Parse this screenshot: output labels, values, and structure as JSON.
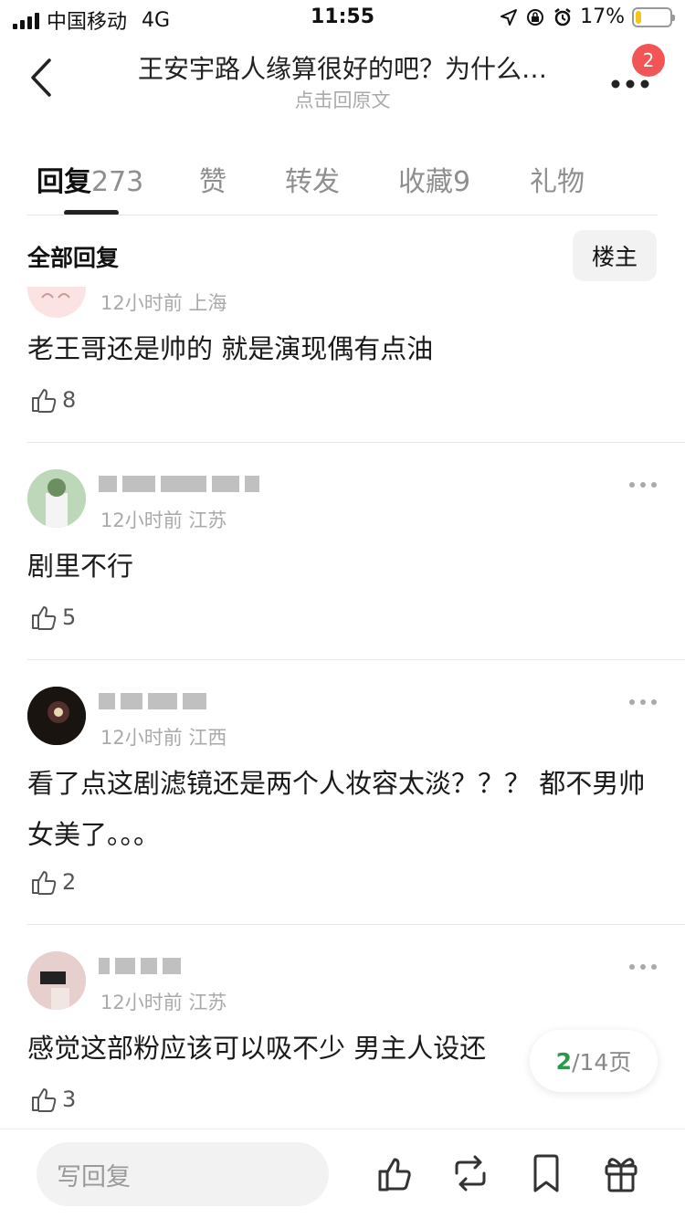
{
  "status": {
    "carrier": "中国移动",
    "network": "4G",
    "time": "11:55",
    "battery_text": "17%",
    "battery_level": 0.17,
    "battery_color": "#f5c518"
  },
  "nav": {
    "title": "王安宇路人缘算很好的吧？为什么…",
    "subtitle": "点击回原文",
    "badge": "2",
    "back_icon": "chevron-left-icon",
    "more_icon": "more-horizontal-icon"
  },
  "tabs": [
    {
      "label": "回复",
      "count": "273",
      "active": true
    },
    {
      "label": "赞",
      "count": "",
      "active": false
    },
    {
      "label": "转发",
      "count": "",
      "active": false
    },
    {
      "label": "收藏",
      "count": "9",
      "active": false
    },
    {
      "label": "礼物",
      "count": "",
      "active": false
    }
  ],
  "filter": {
    "all_label": "全部回复",
    "op_label": "楼主"
  },
  "comments": [
    {
      "meta": "12小时前 上海",
      "text": "老王哥还是帅的 就是演现偶有点油",
      "likes": "8"
    },
    {
      "meta": "12小时前 江苏",
      "text": "剧里不行",
      "likes": "5"
    },
    {
      "meta": "12小时前 江西",
      "text": "看了点这剧滤镜还是两个人妆容太淡？？？ 都不男帅女美了。。。",
      "likes": "2"
    },
    {
      "meta": "12小时前 江苏",
      "text": "感觉这部粉应该可以吸不少 男主人设还",
      "likes": "3"
    }
  ],
  "pager": {
    "current": "2",
    "total": "/14页"
  },
  "bottom": {
    "reply_placeholder": "写回复",
    "icons": [
      "thumbs-up-icon",
      "repost-icon",
      "bookmark-icon",
      "gift-icon"
    ]
  },
  "colors": {
    "accent_green": "#2a9a4a",
    "badge_red": "#f25555"
  }
}
